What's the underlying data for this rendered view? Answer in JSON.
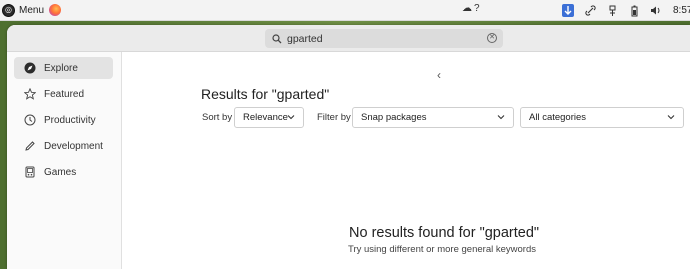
{
  "topbar": {
    "menu_label": "Menu",
    "weather_glyph": "☁",
    "weather_text": "?",
    "clock": "8:57"
  },
  "search": {
    "value": "gparted"
  },
  "sidebar": {
    "items": [
      {
        "label": "Explore",
        "icon": "compass-icon",
        "active": true
      },
      {
        "label": "Featured",
        "icon": "star-icon",
        "active": false
      },
      {
        "label": "Productivity",
        "icon": "clock-icon",
        "active": false
      },
      {
        "label": "Development",
        "icon": "pencil-icon",
        "active": false
      },
      {
        "label": "Games",
        "icon": "gamepad-icon",
        "active": false
      }
    ]
  },
  "main": {
    "results_title": "Results for \"gparted\"",
    "sort_label": "Sort by",
    "sort_value": "Relevance",
    "filter_label": "Filter by",
    "filter_value": "Snap packages",
    "category_value": "All categories",
    "no_results_title": "No results found for \"gparted\"",
    "no_results_hint": "Try using different or more general keywords"
  },
  "colors": {
    "accent_tray": "#3b6fd6",
    "wallpaper": "#5b7a3a"
  }
}
